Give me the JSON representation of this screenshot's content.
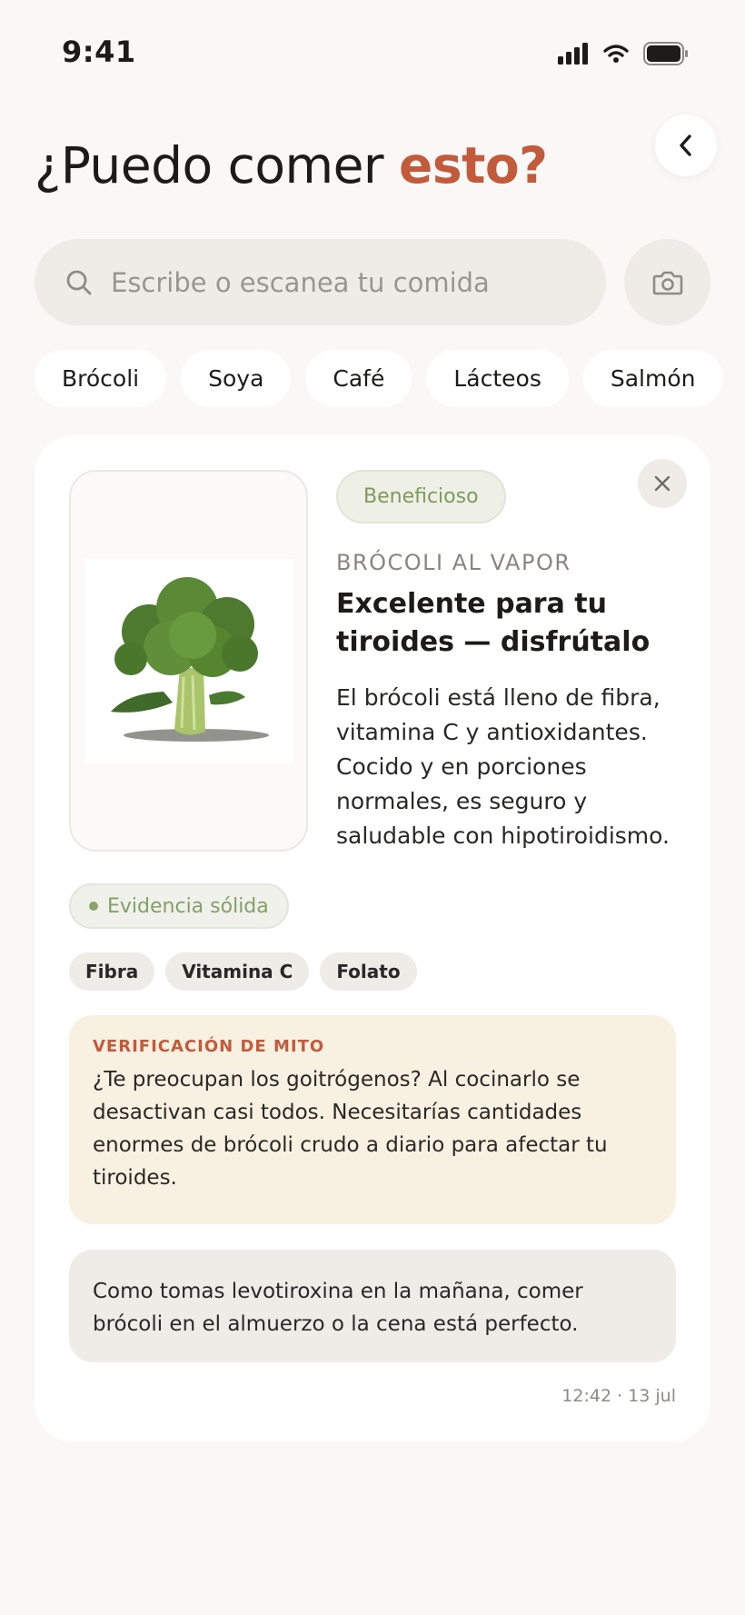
{
  "status_bar": {
    "time": "9:41"
  },
  "header": {
    "title_prefix": "¿Puedo comer ",
    "title_accent": "esto?",
    "accent_color": "#c25a3c"
  },
  "search": {
    "placeholder": "Escribe o escanea tu comida",
    "icon": "search-icon",
    "camera_icon": "camera-icon"
  },
  "quick_chips": [
    {
      "label": "Brócoli"
    },
    {
      "label": "Soya"
    },
    {
      "label": "Café"
    },
    {
      "label": "Lácteos"
    },
    {
      "label": "Salmón"
    }
  ],
  "result": {
    "verdict": "Beneficioso",
    "verdict_color": "#7e9a5e",
    "food_name": "BRÓCOLI AL VAPOR",
    "headline": "Excelente para tu tiroides — disfrútalo",
    "description": "El brócoli está lleno de fibra, vitamina C y antioxidantes. Cocido y en porciones normales, es seguro y saludable con hipotiroidismo.",
    "evidence": "Evidencia sólida",
    "nutrients": [
      {
        "label": "Fibra"
      },
      {
        "label": "Vitamina C"
      },
      {
        "label": "Folato"
      }
    ],
    "myth": {
      "label": "VERIFICACIÓN DE MITO",
      "text": "¿Te preocupan los goitrógenos? Al cocinarlo se desactivan casi todos. Necesitarías cantidades enormes de brócoli crudo a diario para afectar tu tiroides."
    },
    "note": "Como tomas levotiroxina en la mañana, comer brócoli en el almuerzo o la cena está perfecto.",
    "timestamp": "12:42 · 13 jul"
  }
}
